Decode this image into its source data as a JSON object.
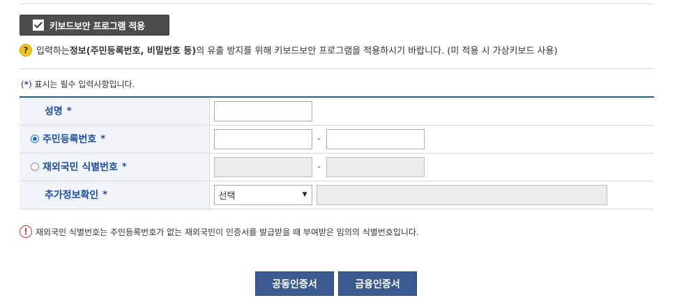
{
  "keyboard_security": {
    "label": "키보드보안 프로그램 적용",
    "checked": true,
    "icon": "check-icon"
  },
  "notice": {
    "icon": "question-icon",
    "prefix": "입력하는 ",
    "bold1": "정보(주민등록번호, 비밀번호 등)",
    "text": "의 유출 방지를 위해 키보드보안 프로그램을 적용하시기 바랍니다. (미 적용 시 가상키보드 사용)"
  },
  "required_note": {
    "open": "(",
    "star": "*",
    "close": ") 표시는 필수 입력사항입니다."
  },
  "form": {
    "required_mark": "*",
    "name": {
      "label": "성명",
      "value": ""
    },
    "resident_no": {
      "label": "주민등록번호",
      "selected": true,
      "dash": "-",
      "part1": "",
      "part2": ""
    },
    "foreigner_no": {
      "label": "재외국민 식별번호",
      "selected": false,
      "dash": "-",
      "disabled": true
    },
    "extra_verify": {
      "label": "추가정보확인",
      "select_value": "선택",
      "value": ""
    }
  },
  "warning": {
    "icon": "exclamation-icon",
    "text": "재외국민 식별번호는 주민등록번호가 없는 재외국민이 인증서를 발급받을 때 부여받은 임의의 식별번호입니다."
  },
  "buttons": {
    "joint_cert": "공동인증서",
    "financial_cert": "금융인증서"
  },
  "colors": {
    "button_bg": "#3b5a8f",
    "label_text": "#1f4ea1",
    "header_border": "#2c5a8c"
  }
}
